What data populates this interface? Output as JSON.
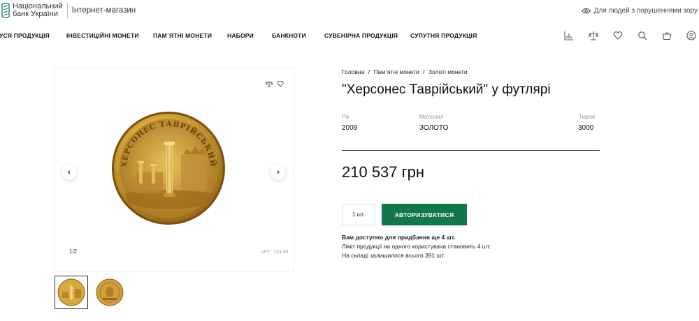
{
  "header": {
    "bank_name_line1": "Національний",
    "bank_name_line2": "банк України",
    "shop_name": "Інтернет-магазин",
    "vision_link": "Для людей з порушеннями зору",
    "accent": "#12784a"
  },
  "nav": {
    "items": [
      "УСЯ ПРОДУКЦІЯ",
      "ІНВЕСТИЦІЙНІ МОНЕТИ",
      "ПАМ`ЯТНІ МОНЕТИ",
      "НАБОРИ",
      "БАНКНОТИ",
      "СУВЕНІРНА ПРОДУКЦІЯ",
      "СУПУТНЯ ПРОДУКЦІЯ"
    ],
    "icons": [
      "stats-icon",
      "compare-icon",
      "heart-icon",
      "search-icon",
      "cart-icon",
      "user-icon"
    ]
  },
  "breadcrumbs": {
    "home": "Головна",
    "sep": "/",
    "category": "Пам`ятні монети",
    "subcategory": "Золоті монети"
  },
  "product": {
    "title": "\"Херсонес Таврійський\" у футлярі",
    "coin_legend": "ХЕРСОНЕС ТАВРІЙСЬКИЙ",
    "specs": {
      "year_label": "Рік",
      "year": "2009",
      "material_label": "Матеріал",
      "material": "ЗОЛОТО",
      "mintage_label": "Тираж",
      "mintage": "3000"
    },
    "price": "210 537 грн",
    "quantity": "1 шт.",
    "auth_button": "АВТОРИЗУВАТИСЯ",
    "availability": {
      "line1": "Вам доступно для придбання ще 4 шт.",
      "line2": "Ліміт продукції на одного користувача становить 4 шт.",
      "line3": "На складі залишилося всього 391 шт."
    }
  },
  "gallery": {
    "counter": "1/2",
    "sku": "АРТ: 10139",
    "prev": "‹",
    "next": "›"
  }
}
